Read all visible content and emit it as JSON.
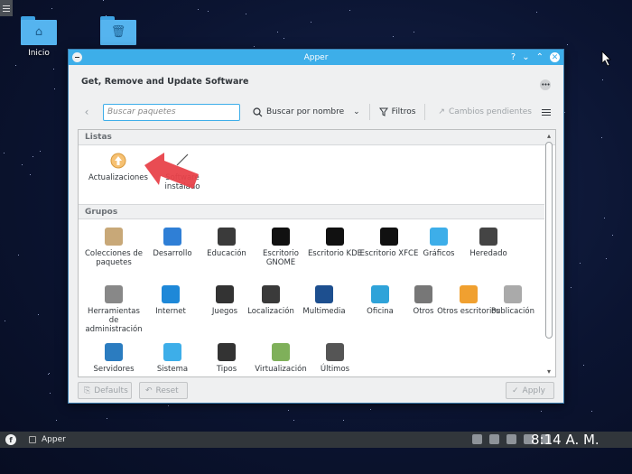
{
  "desktop": {
    "icons": [
      {
        "label": "Inicio",
        "glyph": "⌂"
      },
      {
        "label": "",
        "glyph": "🗑"
      }
    ]
  },
  "window": {
    "title": "Apper",
    "header": "Get, Remove and Update Software",
    "toolbar": {
      "search_placeholder": "Buscar paquetes",
      "search_by": "Buscar por nombre",
      "filters": "Filtros",
      "pending": "Cambios pendientes"
    },
    "sections": {
      "listas": "Listas",
      "grupos": "Grupos"
    },
    "lists": [
      {
        "label": "Actualizaciones",
        "icon": "update-icon"
      },
      {
        "label": "Software instalado",
        "icon": "installed-icon"
      }
    ],
    "groups": [
      {
        "label": "Colecciones de paquetes",
        "icon": "package-collection-icon",
        "color": "#c8a878"
      },
      {
        "label": "Desarrollo",
        "icon": "development-icon",
        "color": "#2f7fd6"
      },
      {
        "label": "Educación",
        "icon": "education-icon",
        "color": "#3a3a3a"
      },
      {
        "label": "Escritorio GNOME",
        "icon": "gnome-icon",
        "color": "#111111"
      },
      {
        "label": "Escritorio KDE",
        "icon": "kde-icon",
        "color": "#111111"
      },
      {
        "label": "Escritorio XFCE",
        "icon": "xfce-icon",
        "color": "#111111"
      },
      {
        "label": "Gráficos",
        "icon": "graphics-icon",
        "color": "#3daee9"
      },
      {
        "label": "Heredado",
        "icon": "legacy-icon",
        "color": "#444444"
      },
      {
        "label": "Herramientas de administración",
        "icon": "admin-tools-icon",
        "color": "#888888"
      },
      {
        "label": "Internet",
        "icon": "internet-icon",
        "color": "#1e88d8"
      },
      {
        "label": "Juegos",
        "icon": "games-icon",
        "color": "#333333"
      },
      {
        "label": "Localización",
        "icon": "localization-icon",
        "color": "#3a3a3a"
      },
      {
        "label": "Multimedia",
        "icon": "multimedia-icon",
        "color": "#1d4f8f"
      },
      {
        "label": "Oficina",
        "icon": "office-icon",
        "color": "#2fa3d9"
      },
      {
        "label": "Otros",
        "icon": "others-icon",
        "color": "#777777"
      },
      {
        "label": "Otros escritorios",
        "icon": "other-desktops-icon",
        "color": "#f0a030"
      },
      {
        "label": "Publicación",
        "icon": "publishing-icon",
        "color": "#aaaaaa"
      },
      {
        "label": "Servidores",
        "icon": "servers-icon",
        "color": "#2b7cc0"
      },
      {
        "label": "Sistema",
        "icon": "system-icon",
        "color": "#3daee9"
      },
      {
        "label": "Tipos",
        "icon": "fonts-icon",
        "color": "#333333"
      },
      {
        "label": "Virtualización",
        "icon": "virtualization-icon",
        "color": "#7fb05a"
      },
      {
        "label": "Últimos",
        "icon": "recent-icon",
        "color": "#555555"
      }
    ],
    "buttons": {
      "defaults": "Defaults",
      "reset": "Reset",
      "apply": "Apply"
    }
  },
  "taskbar": {
    "app": "Apper",
    "clock": "8:14 A. M."
  },
  "colors": {
    "accent": "#3daee9",
    "window_bg": "#eff0f1",
    "annotation": "#e8424a"
  }
}
